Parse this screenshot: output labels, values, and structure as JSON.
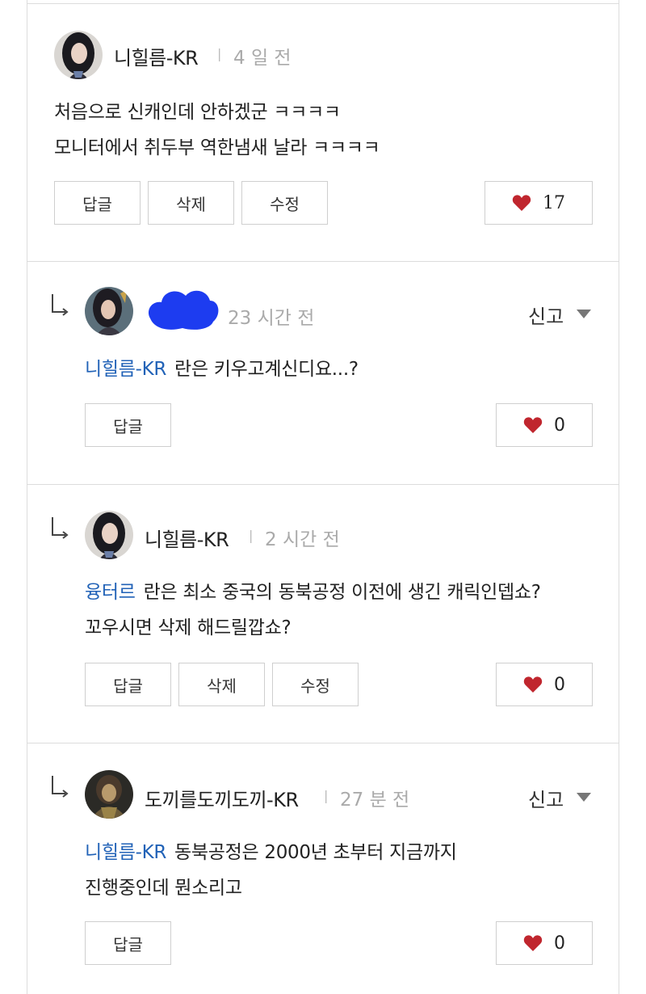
{
  "colors": {
    "mention": "#2162b7",
    "heart": "#c0262e",
    "border": "#dcdcdc",
    "time": "#aaaaaa"
  },
  "comments": [
    {
      "author": "니힐름-KR",
      "time": "4 일 전",
      "lines": [
        "처음으로 신캐인데 안하겠군 ㅋㅋㅋㅋ",
        "모니터에서 취두부 역한냄새 날라 ㅋㅋㅋㅋ"
      ],
      "buttons": {
        "reply": "답글",
        "delete": "삭제",
        "edit": "수정"
      },
      "likes": "17"
    },
    {
      "author_hidden": true,
      "time": "23 시간 전",
      "report": "신고",
      "mention": "니힐름-KR",
      "lines": [
        "란은 키우고계신디요...?"
      ],
      "buttons": {
        "reply": "답글"
      },
      "likes": "0"
    },
    {
      "author": "니힐름-KR",
      "time": "2 시간 전",
      "mention": "융터르",
      "lines": [
        "란은 최소 중국의 동북공정 이전에 생긴 캐릭인뎁쇼?",
        "꼬우시면 삭제 해드릴깝쇼?"
      ],
      "buttons": {
        "reply": "답글",
        "delete": "삭제",
        "edit": "수정"
      },
      "likes": "0"
    },
    {
      "author": "도끼를도끼도끼-KR",
      "time": "27 분 전",
      "report": "신고",
      "mention": "니힐름-KR",
      "lines": [
        "동북공정은 2000년 초부터 지금까지",
        "진행중인데 뭔소리고"
      ],
      "buttons": {
        "reply": "답글"
      },
      "likes": "0"
    }
  ]
}
